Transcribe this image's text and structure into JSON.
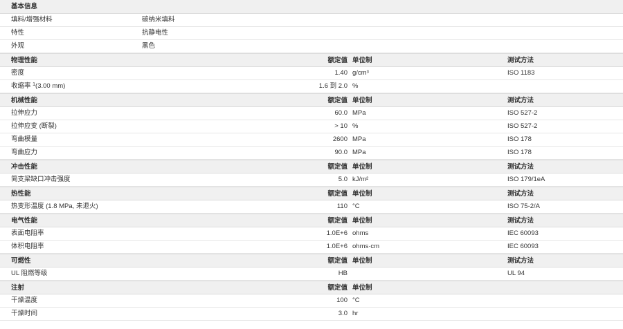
{
  "basic": {
    "title": "基本信息",
    "rows": [
      {
        "label": "填料/增强材料",
        "value": "碳纳米填料"
      },
      {
        "label": "特性",
        "value": "抗静电性"
      },
      {
        "label": "外观",
        "value": "黑色"
      }
    ]
  },
  "col_headers": {
    "nominal": "额定值",
    "unit": "单位制",
    "test": "测试方法"
  },
  "sections": [
    {
      "title": "物理性能",
      "rows": [
        {
          "name": "密度",
          "sup": "",
          "name_suffix": "",
          "nominal": "1.40",
          "unit": "g/cm³",
          "test": "ISO 1183"
        },
        {
          "name": "收缩率 ",
          "sup": "1",
          "name_suffix": "(3.00 mm)",
          "nominal": "1.6 到 2.0",
          "unit": "%",
          "test": ""
        }
      ]
    },
    {
      "title": "机械性能",
      "rows": [
        {
          "name": "拉伸应力",
          "sup": "",
          "name_suffix": "",
          "nominal": "60.0",
          "unit": "MPa",
          "test": "ISO 527-2"
        },
        {
          "name": "拉伸应变 (断裂)",
          "sup": "",
          "name_suffix": "",
          "nominal": "> 10",
          "unit": "%",
          "test": "ISO 527-2"
        },
        {
          "name": "弯曲模量",
          "sup": "",
          "name_suffix": "",
          "nominal": "2600",
          "unit": "MPa",
          "test": "ISO 178"
        },
        {
          "name": "弯曲应力",
          "sup": "",
          "name_suffix": "",
          "nominal": "90.0",
          "unit": "MPa",
          "test": "ISO 178"
        }
      ]
    },
    {
      "title": "冲击性能",
      "rows": [
        {
          "name": "简支梁缺口冲击强度",
          "sup": "",
          "name_suffix": "",
          "nominal": "5.0",
          "unit": "kJ/m²",
          "test": "ISO 179/1eA"
        }
      ]
    },
    {
      "title": "热性能",
      "rows": [
        {
          "name": "热变形温度 (1.8 MPa, 未退火)",
          "sup": "",
          "name_suffix": "",
          "nominal": "110",
          "unit": "°C",
          "test": "ISO 75-2/A"
        }
      ]
    },
    {
      "title": "电气性能",
      "rows": [
        {
          "name": "表面电阻率",
          "sup": "",
          "name_suffix": "",
          "nominal": "1.0E+6",
          "unit": "ohms",
          "test": "IEC 60093"
        },
        {
          "name": "体积电阻率",
          "sup": "",
          "name_suffix": "",
          "nominal": "1.0E+6",
          "unit": "ohms·cm",
          "test": "IEC 60093"
        }
      ]
    },
    {
      "title": "可燃性",
      "show_unit": true,
      "rows": [
        {
          "name": "UL 阻燃等级",
          "sup": "",
          "name_suffix": "",
          "nominal": "HB",
          "unit": "",
          "test": "UL 94"
        }
      ]
    },
    {
      "title": "注射",
      "no_test": true,
      "rows": [
        {
          "name": "干燥温度",
          "sup": "",
          "name_suffix": "",
          "nominal": "100",
          "unit": "°C",
          "test": ""
        },
        {
          "name": "干燥时间",
          "sup": "",
          "name_suffix": "",
          "nominal": "3.0",
          "unit": "hr",
          "test": ""
        }
      ]
    }
  ]
}
